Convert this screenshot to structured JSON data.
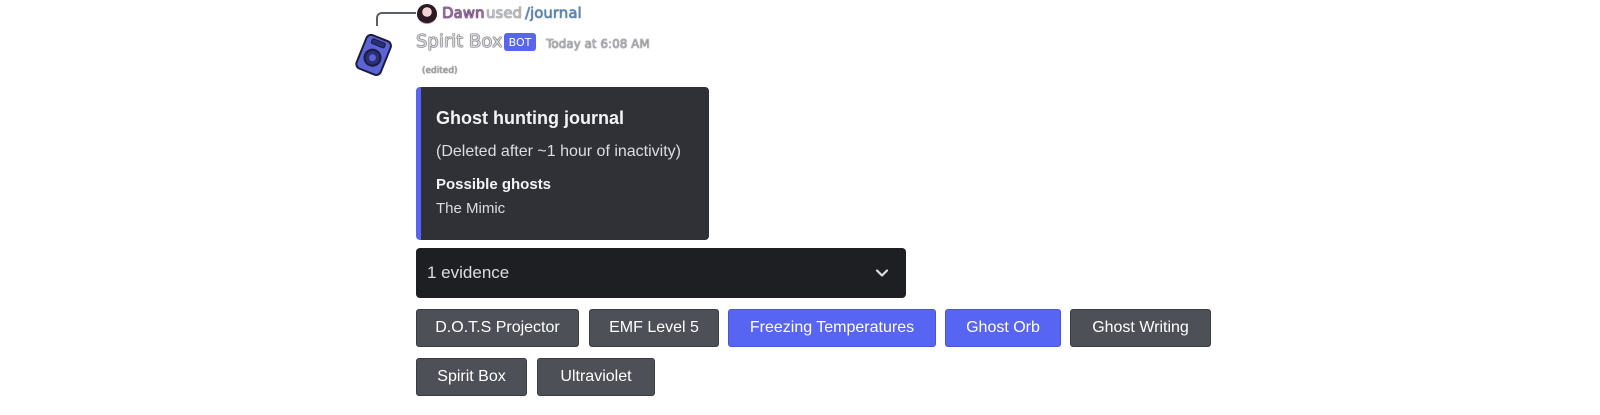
{
  "reply": {
    "user": "Dawn",
    "used": "used",
    "command": "/journal"
  },
  "message": {
    "author": "Spirit Box",
    "bot_tag": "BOT",
    "timestamp": "Today at 6:08 AM",
    "edited": "(edited)"
  },
  "embed": {
    "accent_color": "#5865f2",
    "title": "Ghost hunting journal",
    "description": "(Deleted after ~1 hour of inactivity)",
    "field_name": "Possible ghosts",
    "field_value": "The Mimic"
  },
  "select": {
    "value": "1 evidence"
  },
  "buttons": [
    {
      "label": "D.O.T.S Projector",
      "style": "secondary"
    },
    {
      "label": "EMF Level 5",
      "style": "secondary"
    },
    {
      "label": "Freezing Temperatures",
      "style": "primary"
    },
    {
      "label": "Ghost Orb",
      "style": "primary"
    },
    {
      "label": "Ghost Writing",
      "style": "secondary"
    },
    {
      "label": "Spirit Box",
      "style": "secondary"
    },
    {
      "label": "Ultraviolet",
      "style": "secondary"
    }
  ]
}
